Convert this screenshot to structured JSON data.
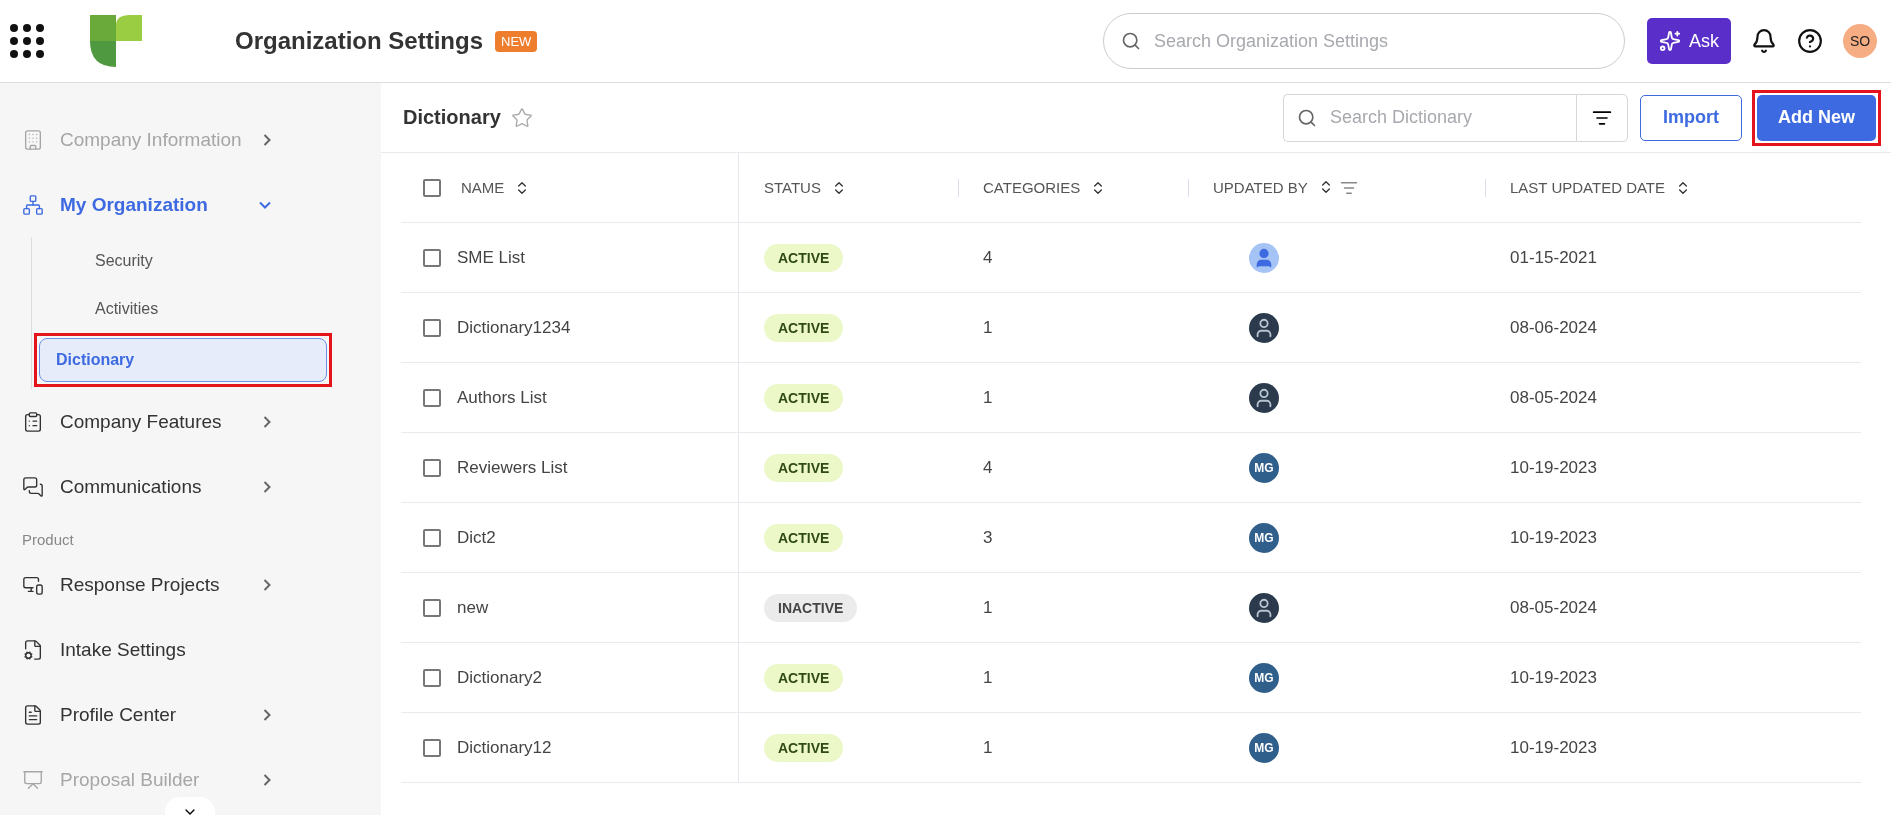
{
  "header": {
    "title": "Organization Settings",
    "badge": "NEW",
    "search": {
      "placeholder": "Search Organization Settings"
    },
    "ask_button": "Ask",
    "user_initials": "SO"
  },
  "sidebar": {
    "items": [
      {
        "kind": "nav",
        "label": "Company Information",
        "disabled": true,
        "expanded": false,
        "selected": false
      },
      {
        "kind": "nav",
        "label": "My Organization",
        "disabled": false,
        "expanded": true,
        "selected": true,
        "children": [
          {
            "label": "Security",
            "selected": false,
            "highlighted": false
          },
          {
            "label": "Activities",
            "selected": false,
            "highlighted": false
          },
          {
            "label": "Dictionary",
            "selected": true,
            "highlighted": true
          }
        ]
      },
      {
        "kind": "nav",
        "label": "Company Features",
        "disabled": false,
        "expanded": false,
        "selected": false
      },
      {
        "kind": "nav",
        "label": "Communications",
        "disabled": false,
        "expanded": false,
        "selected": false
      },
      {
        "kind": "section",
        "label": "Product"
      },
      {
        "kind": "nav",
        "label": "Response Projects",
        "disabled": false,
        "expanded": false,
        "selected": false
      },
      {
        "kind": "leaf",
        "label": "Intake Settings",
        "disabled": false,
        "selected": false
      },
      {
        "kind": "nav",
        "label": "Profile Center",
        "disabled": false,
        "expanded": false,
        "selected": false
      },
      {
        "kind": "nav",
        "label": "Proposal Builder",
        "disabled": true,
        "expanded": false,
        "selected": false
      }
    ]
  },
  "page": {
    "title": "Dictionary",
    "search": {
      "placeholder": "Search Dictionary"
    },
    "import_button": "Import",
    "add_button": {
      "label": "Add New",
      "highlighted": true
    }
  },
  "table": {
    "all_checked": false,
    "columns": [
      {
        "label": "NAME",
        "kind": "sort"
      },
      {
        "label": "STATUS",
        "kind": "sort"
      },
      {
        "label": "CATEGORIES",
        "kind": "sort"
      },
      {
        "label": "UPDATED BY",
        "kind": "sort_filter"
      },
      {
        "label": "LAST UPDATED DATE",
        "kind": "sort"
      }
    ],
    "rows": [
      {
        "checked": false,
        "name": "SME List",
        "status": "ACTIVE",
        "active": true,
        "categories": "4",
        "avatar": {
          "kind": "generic"
        },
        "date": "01-15-2021"
      },
      {
        "checked": false,
        "name": "Dictionary1234",
        "status": "ACTIVE",
        "active": true,
        "categories": "1",
        "avatar": {
          "kind": "photo"
        },
        "date": "08-06-2024"
      },
      {
        "checked": false,
        "name": "Authors List",
        "status": "ACTIVE",
        "active": true,
        "categories": "1",
        "avatar": {
          "kind": "photo"
        },
        "date": "08-05-2024"
      },
      {
        "checked": false,
        "name": "Reviewers List",
        "status": "ACTIVE",
        "active": true,
        "categories": "4",
        "avatar": {
          "kind": "initials",
          "initials": "MG"
        },
        "date": "10-19-2023"
      },
      {
        "checked": false,
        "name": "Dict2",
        "status": "ACTIVE",
        "active": true,
        "categories": "3",
        "avatar": {
          "kind": "initials",
          "initials": "MG"
        },
        "date": "10-19-2023"
      },
      {
        "checked": false,
        "name": "new",
        "status": "INACTIVE",
        "active": false,
        "categories": "1",
        "avatar": {
          "kind": "photo"
        },
        "date": "08-05-2024"
      },
      {
        "checked": false,
        "name": "Dictionary2",
        "status": "ACTIVE",
        "active": true,
        "categories": "1",
        "avatar": {
          "kind": "initials",
          "initials": "MG"
        },
        "date": "10-19-2023"
      },
      {
        "checked": false,
        "name": "Dictionary12",
        "status": "ACTIVE",
        "active": true,
        "categories": "1",
        "avatar": {
          "kind": "initials",
          "initials": "MG"
        },
        "date": "10-19-2023"
      }
    ]
  }
}
